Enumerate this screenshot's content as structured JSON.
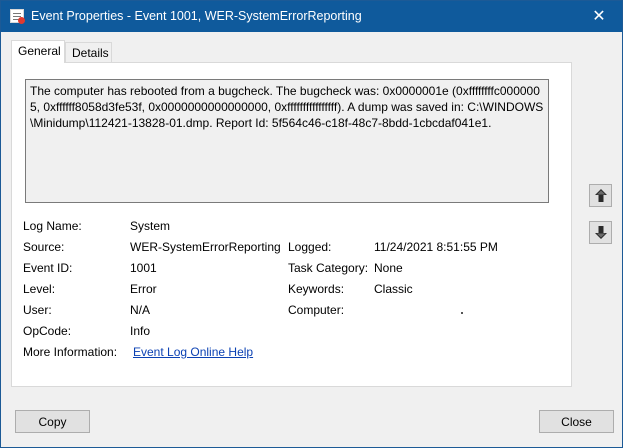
{
  "window": {
    "title": "Event Properties - Event 1001, WER-SystemErrorReporting",
    "close_glyph": "✕",
    "app_icon": "event-properties-icon"
  },
  "tabs": [
    {
      "label": "General",
      "selected": true
    },
    {
      "label": "Details",
      "selected": false
    }
  ],
  "description": "The computer has rebooted from a bugcheck.  The bugcheck was: 0x0000001e (0xffffffffc0000005, 0xffffff8058d3fe53f, 0x0000000000000000, 0xffffffffffffffff). A dump was saved in: C:\\WINDOWS\\Minidump\\112421-13828-01.dmp. Report Id: 5f564c46-c18f-48c7-8bdd-1cbcdaf041e1.",
  "fields": {
    "log_name": {
      "label": "Log Name:",
      "value": "System"
    },
    "source": {
      "label": "Source:",
      "value": "WER-SystemErrorReporting"
    },
    "event_id": {
      "label": "Event ID:",
      "value": "1001"
    },
    "level": {
      "label": "Level:",
      "value": "Error"
    },
    "user": {
      "label": "User:",
      "value": "N/A"
    },
    "opcode": {
      "label": "OpCode:",
      "value": "Info"
    },
    "more_info": {
      "label": "More Information:",
      "value": "Event Log Online Help"
    },
    "logged": {
      "label": "Logged:",
      "value": "11/24/2021 8:51:55 PM"
    },
    "task_category": {
      "label": "Task Category:",
      "value": "None"
    },
    "keywords": {
      "label": "Keywords:",
      "value": "Classic"
    },
    "computer": {
      "label": "Computer:",
      "value": ""
    }
  },
  "buttons": {
    "copy": "Copy",
    "close": "Close",
    "up_icon": "arrow-up-icon",
    "down_icon": "arrow-down-icon"
  },
  "colors": {
    "titlebar": "#0f5a9c",
    "link": "#0b41b3",
    "window_bg": "#f0f0f0"
  }
}
